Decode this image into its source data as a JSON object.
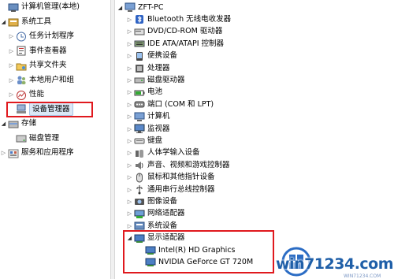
{
  "left_tree": {
    "items": [
      {
        "label": "计算机管理(本地)",
        "level": 0,
        "arrow": "none",
        "icon": "computer-management-icon"
      },
      {
        "label": "系统工具",
        "level": 1,
        "arrow": "open",
        "icon": "system-tools-icon"
      },
      {
        "label": "任务计划程序",
        "level": 2,
        "arrow": "closed",
        "icon": "task-scheduler-icon"
      },
      {
        "label": "事件查看器",
        "level": 2,
        "arrow": "closed",
        "icon": "event-viewer-icon"
      },
      {
        "label": "共享文件夹",
        "level": 2,
        "arrow": "closed",
        "icon": "shared-folders-icon"
      },
      {
        "label": "本地用户和组",
        "level": 2,
        "arrow": "closed",
        "icon": "local-users-icon"
      },
      {
        "label": "性能",
        "level": 2,
        "arrow": "closed",
        "icon": "performance-icon"
      },
      {
        "label": "设备管理器",
        "level": 2,
        "arrow": "none",
        "icon": "device-manager-icon",
        "selected": true
      },
      {
        "label": "存储",
        "level": 1,
        "arrow": "open",
        "icon": "storage-icon"
      },
      {
        "label": "磁盘管理",
        "level": 2,
        "arrow": "none",
        "icon": "disk-management-icon"
      },
      {
        "label": "服务和应用程序",
        "level": 1,
        "arrow": "closed",
        "icon": "services-apps-icon"
      }
    ]
  },
  "right_tree": {
    "root": {
      "label": "ZFT-PC",
      "icon": "computer-icon"
    },
    "items": [
      {
        "label": "Bluetooth 无线电收发器",
        "icon": "bluetooth-icon",
        "arrow": "closed",
        "level": 1
      },
      {
        "label": "DVD/CD-ROM 驱动器",
        "icon": "dvd-drive-icon",
        "arrow": "closed",
        "level": 1
      },
      {
        "label": "IDE ATA/ATAPI 控制器",
        "icon": "ide-controller-icon",
        "arrow": "closed",
        "level": 1
      },
      {
        "label": "便携设备",
        "icon": "portable-device-icon",
        "arrow": "closed",
        "level": 1
      },
      {
        "label": "处理器",
        "icon": "processor-icon",
        "arrow": "closed",
        "level": 1
      },
      {
        "label": "磁盘驱动器",
        "icon": "disk-drive-icon",
        "arrow": "closed",
        "level": 1
      },
      {
        "label": "电池",
        "icon": "battery-icon",
        "arrow": "closed",
        "level": 1
      },
      {
        "label": "端口 (COM 和 LPT)",
        "icon": "port-icon",
        "arrow": "closed",
        "level": 1
      },
      {
        "label": "计算机",
        "icon": "computer-icon",
        "arrow": "closed",
        "level": 1
      },
      {
        "label": "监视器",
        "icon": "monitor-icon",
        "arrow": "closed",
        "level": 1
      },
      {
        "label": "键盘",
        "icon": "keyboard-icon",
        "arrow": "closed",
        "level": 1
      },
      {
        "label": "人体学输入设备",
        "icon": "hid-icon",
        "arrow": "closed",
        "level": 1
      },
      {
        "label": "声音、视频和游戏控制器",
        "icon": "sound-icon",
        "arrow": "closed",
        "level": 1
      },
      {
        "label": "鼠标和其他指针设备",
        "icon": "mouse-icon",
        "arrow": "closed",
        "level": 1
      },
      {
        "label": "通用串行总线控制器",
        "icon": "usb-icon",
        "arrow": "closed",
        "level": 1
      },
      {
        "label": "图像设备",
        "icon": "imaging-device-icon",
        "arrow": "closed",
        "level": 1
      },
      {
        "label": "网络适配器",
        "icon": "network-adapter-icon",
        "arrow": "closed",
        "level": 1
      },
      {
        "label": "系统设备",
        "icon": "system-device-icon",
        "arrow": "closed",
        "level": 1
      },
      {
        "label": "显示适配器",
        "icon": "display-adapter-icon",
        "arrow": "open",
        "level": 1
      },
      {
        "label": "Intel(R) HD Graphics",
        "icon": "display-adapter-icon",
        "arrow": "none",
        "level": 2
      },
      {
        "label": "NVIDIA GeForce GT 720M",
        "icon": "display-adapter-icon",
        "arrow": "none",
        "level": 2
      }
    ]
  },
  "watermark": {
    "text": "win71234.com",
    "sub": "WIN71234.COM"
  },
  "colors": {
    "highlight": "#e0191e",
    "selection": "#dbe8f6",
    "watermark": "#1f5fa8"
  }
}
